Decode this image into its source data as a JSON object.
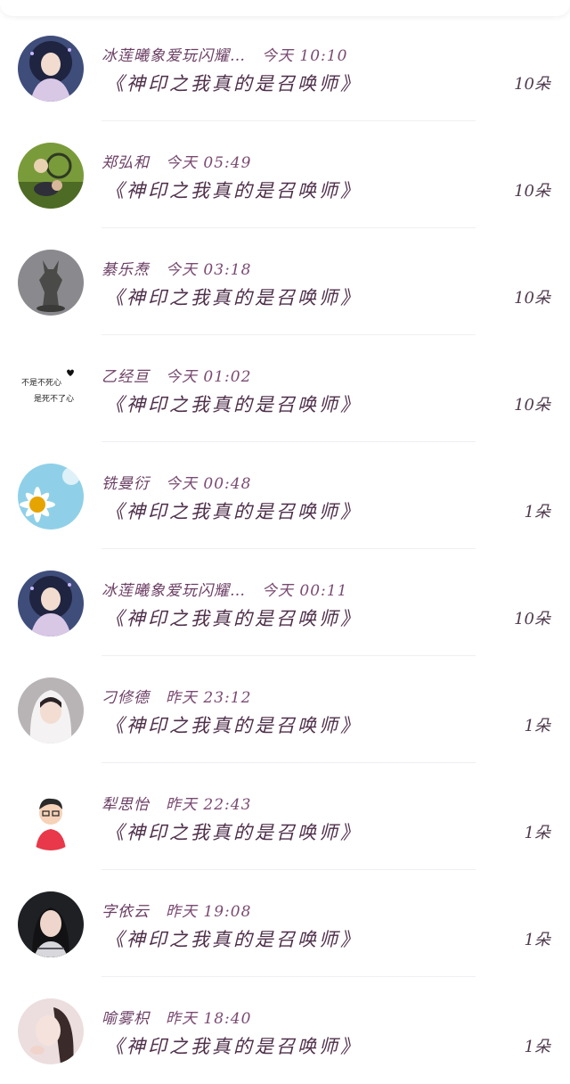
{
  "items": [
    {
      "name": "冰莲曦象爱玩闪耀…",
      "time": "今天 10:10",
      "book": "《神印之我真的是召唤师》",
      "count": "10朵",
      "avatar": "avatar-anime-girl"
    },
    {
      "name": "郑弘和",
      "time": "今天 05:49",
      "book": "《神印之我真的是召唤师》",
      "count": "10朵",
      "avatar": "avatar-couple-bicycle"
    },
    {
      "name": "綦乐焘",
      "time": "今天 03:18",
      "book": "《神印之我真的是召唤师》",
      "count": "10朵",
      "avatar": "avatar-bronze-statue"
    },
    {
      "name": "乙经亘",
      "time": "今天 01:02",
      "book": "《神印之我真的是召唤师》",
      "count": "10朵",
      "avatar": "avatar-text",
      "avatar_text_1": "不是不死心",
      "avatar_text_2": "是死不了心"
    },
    {
      "name": "铣曼衍",
      "time": "今天 00:48",
      "book": "《神印之我真的是召唤师》",
      "count": "1朵",
      "avatar": "avatar-daisy-sky"
    },
    {
      "name": "冰莲曦象爱玩闪耀…",
      "time": "今天 00:11",
      "book": "《神印之我真的是召唤师》",
      "count": "10朵",
      "avatar": "avatar-anime-girl"
    },
    {
      "name": "刁修德",
      "time": "昨天 23:12",
      "book": "《神印之我真的是召唤师》",
      "count": "1朵",
      "avatar": "avatar-girl-hood"
    },
    {
      "name": "犁思怡",
      "time": "昨天 22:43",
      "book": "《神印之我真的是召唤师》",
      "count": "1朵",
      "avatar": "avatar-cartoon-boy"
    },
    {
      "name": "字依云",
      "time": "昨天 19:08",
      "book": "《神印之我真的是召唤师》",
      "count": "1朵",
      "avatar": "avatar-girl-dark"
    },
    {
      "name": "喻雾枳",
      "time": "昨天 18:40",
      "book": "《神印之我真的是召唤师》",
      "count": "1朵",
      "avatar": "avatar-girl-pink"
    }
  ]
}
